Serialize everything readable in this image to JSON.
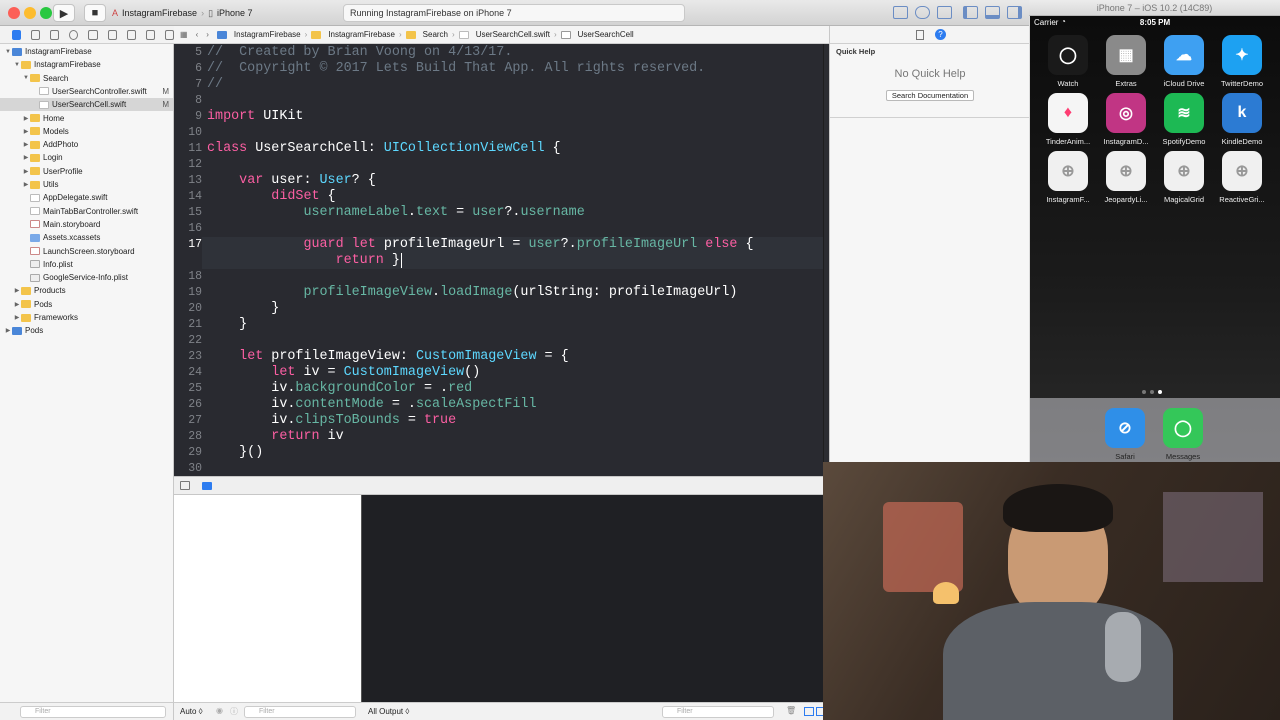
{
  "titlebar": {
    "scheme_target": "InstagramFirebase",
    "scheme_device": "iPhone 7",
    "activity": "Running InstagramFirebase on iPhone 7"
  },
  "navigator": {
    "items": [
      {
        "label": "InstagramFirebase",
        "icon": "project-icon",
        "level": 0,
        "expanded": true
      },
      {
        "label": "InstagramFirebase",
        "icon": "folder-icon",
        "level": 1,
        "expanded": true
      },
      {
        "label": "Search",
        "icon": "folder-icon",
        "level": 2,
        "expanded": true
      },
      {
        "label": "UserSearchController.swift",
        "icon": "swift-file-icon",
        "level": 3,
        "flag": "M"
      },
      {
        "label": "UserSearchCell.swift",
        "icon": "swift-file-icon",
        "level": 3,
        "flag": "M",
        "selected": true
      },
      {
        "label": "Home",
        "icon": "folder-icon",
        "level": 2
      },
      {
        "label": "Models",
        "icon": "folder-icon",
        "level": 2
      },
      {
        "label": "AddPhoto",
        "icon": "folder-icon",
        "level": 2
      },
      {
        "label": "Login",
        "icon": "folder-icon",
        "level": 2
      },
      {
        "label": "UserProfile",
        "icon": "folder-icon",
        "level": 2
      },
      {
        "label": "Utils",
        "icon": "folder-icon",
        "level": 2
      },
      {
        "label": "AppDelegate.swift",
        "icon": "swift-file-icon",
        "level": 2
      },
      {
        "label": "MainTabBarController.swift",
        "icon": "swift-file-icon",
        "level": 2
      },
      {
        "label": "Main.storyboard",
        "icon": "storyboard-icon",
        "level": 2
      },
      {
        "label": "Assets.xcassets",
        "icon": "assets-icon",
        "level": 2
      },
      {
        "label": "LaunchScreen.storyboard",
        "icon": "storyboard-icon",
        "level": 2
      },
      {
        "label": "Info.plist",
        "icon": "plist-icon",
        "level": 2
      },
      {
        "label": "GoogleService-Info.plist",
        "icon": "plist-icon",
        "level": 2
      },
      {
        "label": "Products",
        "icon": "folder-icon",
        "level": 1
      },
      {
        "label": "Pods",
        "icon": "folder-icon",
        "level": 1
      },
      {
        "label": "Frameworks",
        "icon": "folder-icon",
        "level": 1
      },
      {
        "label": "Pods",
        "icon": "project-icon",
        "level": 0
      }
    ]
  },
  "jumpbar": {
    "crumbs": [
      "InstagramFirebase",
      "InstagramFirebase",
      "Search",
      "UserSearchCell.swift",
      "UserSearchCell"
    ]
  },
  "editor": {
    "lines": [
      {
        "n": "5",
        "tokens": [
          [
            "cm",
            "//  Created by Brian Voong on 4/13/17."
          ]
        ]
      },
      {
        "n": "6",
        "tokens": [
          [
            "cm",
            "//  Copyright © 2017 Lets Build That App. All rights reserved."
          ]
        ]
      },
      {
        "n": "7",
        "tokens": [
          [
            "cm",
            "//"
          ]
        ]
      },
      {
        "n": "8",
        "tokens": []
      },
      {
        "n": "9",
        "tokens": [
          [
            "kw",
            "import"
          ],
          [
            "wh",
            " UIKit"
          ]
        ]
      },
      {
        "n": "10",
        "tokens": []
      },
      {
        "n": "11",
        "tokens": [
          [
            "kw",
            "class"
          ],
          [
            "wh",
            " UserSearchCell: "
          ],
          [
            "ty",
            "UICollectionViewCell"
          ],
          [
            "wh",
            " {"
          ]
        ]
      },
      {
        "n": "12",
        "tokens": []
      },
      {
        "n": "13",
        "tokens": [
          [
            "wh",
            "    "
          ],
          [
            "kw",
            "var"
          ],
          [
            "wh",
            " user: "
          ],
          [
            "ty",
            "User"
          ],
          [
            "wh",
            "? {"
          ]
        ]
      },
      {
        "n": "14",
        "tokens": [
          [
            "wh",
            "        "
          ],
          [
            "kw",
            "didSet"
          ],
          [
            "wh",
            " {"
          ]
        ]
      },
      {
        "n": "15",
        "tokens": [
          [
            "wh",
            "            "
          ],
          [
            "pr",
            "usernameLabel"
          ],
          [
            "wh",
            "."
          ],
          [
            "pr",
            "text"
          ],
          [
            "wh",
            " = "
          ],
          [
            "pr",
            "user"
          ],
          [
            "wh",
            "?."
          ],
          [
            "pr",
            "username"
          ]
        ]
      },
      {
        "n": "16",
        "tokens": []
      },
      {
        "n": "17",
        "tokens": [
          [
            "wh",
            "            "
          ],
          [
            "kw",
            "guard"
          ],
          [
            "wh",
            " "
          ],
          [
            "kw",
            "let"
          ],
          [
            "wh",
            " profileImageUrl = "
          ],
          [
            "pr",
            "user"
          ],
          [
            "wh",
            "?."
          ],
          [
            "pr",
            "profileImageUrl"
          ],
          [
            "wh",
            " "
          ],
          [
            "kw",
            "else"
          ],
          [
            "wh",
            " {"
          ]
        ],
        "current": true
      },
      {
        "n": "",
        "tokens": [
          [
            "wh",
            "                "
          ],
          [
            "kw",
            "return"
          ],
          [
            "wh",
            " }"
          ]
        ],
        "current": true
      },
      {
        "n": "18",
        "tokens": []
      },
      {
        "n": "19",
        "tokens": [
          [
            "wh",
            "            "
          ],
          [
            "pr",
            "profileImageView"
          ],
          [
            "wh",
            "."
          ],
          [
            "pr",
            "loadImage"
          ],
          [
            "wh",
            "(urlString: profileImageUrl)"
          ]
        ]
      },
      {
        "n": "20",
        "tokens": [
          [
            "wh",
            "        }"
          ]
        ]
      },
      {
        "n": "21",
        "tokens": [
          [
            "wh",
            "    }"
          ]
        ]
      },
      {
        "n": "22",
        "tokens": []
      },
      {
        "n": "23",
        "tokens": [
          [
            "wh",
            "    "
          ],
          [
            "kw",
            "let"
          ],
          [
            "wh",
            " profileImageView: "
          ],
          [
            "ty",
            "CustomImageView"
          ],
          [
            "wh",
            " = {"
          ]
        ]
      },
      {
        "n": "24",
        "tokens": [
          [
            "wh",
            "        "
          ],
          [
            "kw",
            "let"
          ],
          [
            "wh",
            " iv = "
          ],
          [
            "ty",
            "CustomImageView"
          ],
          [
            "wh",
            "()"
          ]
        ]
      },
      {
        "n": "25",
        "tokens": [
          [
            "wh",
            "        iv."
          ],
          [
            "pr",
            "backgroundColor"
          ],
          [
            "wh",
            " = ."
          ],
          [
            "pr",
            "red"
          ]
        ]
      },
      {
        "n": "26",
        "tokens": [
          [
            "wh",
            "        iv."
          ],
          [
            "pr",
            "contentMode"
          ],
          [
            "wh",
            " = ."
          ],
          [
            "pr",
            "scaleAspectFill"
          ]
        ]
      },
      {
        "n": "27",
        "tokens": [
          [
            "wh",
            "        iv."
          ],
          [
            "pr",
            "clipsToBounds"
          ],
          [
            "wh",
            " = "
          ],
          [
            "kw",
            "true"
          ]
        ]
      },
      {
        "n": "28",
        "tokens": [
          [
            "wh",
            "        "
          ],
          [
            "kw",
            "return"
          ],
          [
            "wh",
            " iv"
          ]
        ]
      },
      {
        "n": "29",
        "tokens": [
          [
            "wh",
            "    }()"
          ]
        ]
      },
      {
        "n": "30",
        "tokens": []
      }
    ]
  },
  "inspector": {
    "title": "Quick Help",
    "empty": "No Quick Help",
    "search_button": "Search Documentation"
  },
  "debug": {
    "auto_label": "Auto ◊",
    "filter_placeholder": "Filter",
    "output_label": "All Output ◊"
  },
  "simulator": {
    "title": "iPhone 7 – iOS 10.2 (14C89)",
    "carrier": "Carrier",
    "time": "8:05 PM",
    "apps": [
      {
        "label": "Watch",
        "color": "#1a1a1a",
        "glyph": "◯"
      },
      {
        "label": "Extras",
        "color": "#8a8a8a",
        "glyph": "▦"
      },
      {
        "label": "iCloud Drive",
        "color": "#3ea0f2",
        "glyph": "☁"
      },
      {
        "label": "TwitterDemo",
        "color": "#1da1f2",
        "glyph": "✦"
      },
      {
        "label": "TinderAnim...",
        "color": "#f5f5f5",
        "glyph": "♦"
      },
      {
        "label": "InstagramD...",
        "color": "#c13584",
        "glyph": "◎"
      },
      {
        "label": "SpotifyDemo",
        "color": "#1db954",
        "glyph": "≋"
      },
      {
        "label": "KindleDemo",
        "color": "#2c7bd3",
        "glyph": "k"
      },
      {
        "label": "InstagramF...",
        "color": "#f0f0f0",
        "glyph": "⊕"
      },
      {
        "label": "JeopardyLi...",
        "color": "#f0f0f0",
        "glyph": "⊕"
      },
      {
        "label": "MagicalGrid",
        "color": "#f0f0f0",
        "glyph": "⊕"
      },
      {
        "label": "ReactiveGri...",
        "color": "#f0f0f0",
        "glyph": "⊕"
      }
    ],
    "dock": [
      {
        "label": "Safari",
        "color": "#2f8fe8",
        "glyph": "⊘"
      },
      {
        "label": "Messages",
        "color": "#34c759",
        "glyph": "◯"
      }
    ]
  }
}
